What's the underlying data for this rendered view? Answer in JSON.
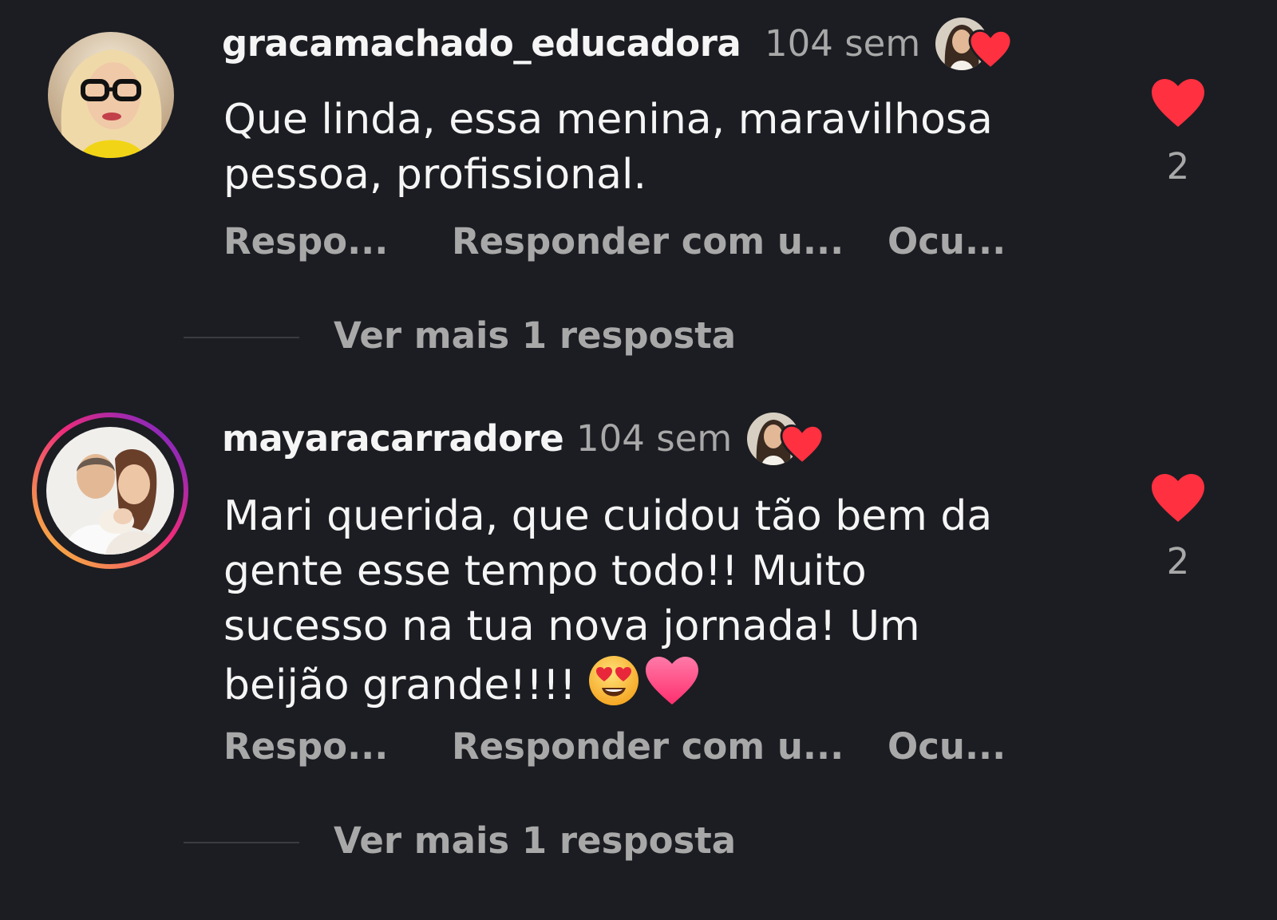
{
  "colors": {
    "background": "#1b1d22",
    "text_primary": "#f5f5f5",
    "text_secondary": "#a8a8a8",
    "heart": "#ff3040",
    "story_ring": [
      "#f9ce34",
      "#ee2a7b",
      "#6228d7"
    ]
  },
  "comments": [
    {
      "username": "gracamachado_educadora",
      "time": "104 sem",
      "liked_by_author": true,
      "text_lines": [
        "Que linda, essa menina, maravilhosa",
        "pessoa, profissional."
      ],
      "like_count": "2",
      "has_story_ring": false,
      "actions": {
        "reply": "Respo...",
        "reply_with": "Responder com u...",
        "hide": "Ocu..."
      },
      "more_replies": "Ver mais 1 resposta"
    },
    {
      "username": "mayaracarradore",
      "time": "104 sem",
      "liked_by_author": true,
      "text_lines": [
        "Mari querida, que cuidou tão bem da",
        "gente esse tempo todo!! Muito",
        "sucesso na tua nova jornada! Um",
        "beijão grande!!!!"
      ],
      "emojis": [
        "smiling-face-with-heart-eyes",
        "pink-heart"
      ],
      "like_count": "2",
      "has_story_ring": true,
      "actions": {
        "reply": "Respo...",
        "reply_with": "Responder com u...",
        "hide": "Ocu..."
      },
      "more_replies": "Ver mais 1 resposta"
    }
  ]
}
